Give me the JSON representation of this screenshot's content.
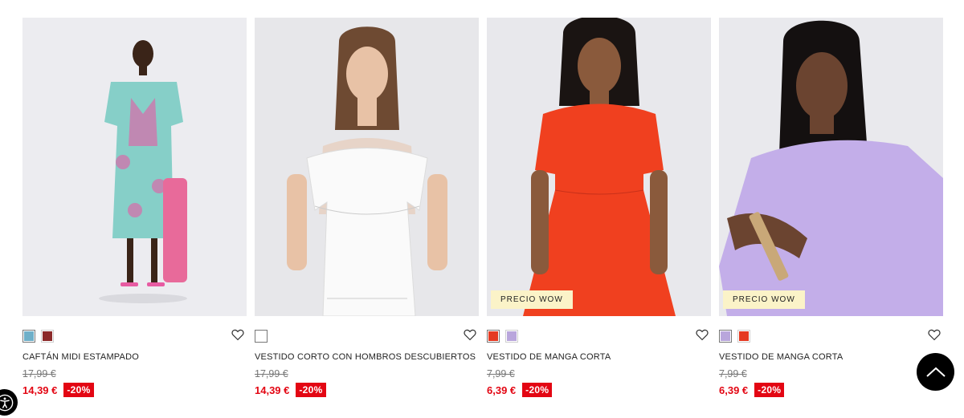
{
  "products": [
    {
      "name": "CAFTÁN MIDI ESTAMPADO",
      "old_price": "17,99 €",
      "price": "14,39 €",
      "discount": "-20%",
      "tag": "",
      "swatches": [
        "#6fb0c9",
        "#8c2a2a"
      ],
      "selected_swatch": 0,
      "photo_bg": "#ececf0",
      "garment_color": "#86cfc8"
    },
    {
      "name": "VESTIDO CORTO CON HOMBROS DESCUBIERTOS",
      "old_price": "17,99 €",
      "price": "14,39 €",
      "discount": "-20%",
      "tag": "",
      "swatches": [
        "#ffffff"
      ],
      "selected_swatch": 0,
      "photo_bg": "#e7e7ea",
      "garment_color": "#fafafa"
    },
    {
      "name": "VESTIDO DE MANGA CORTA",
      "old_price": "7,99 €",
      "price": "6,39 €",
      "discount": "-20%",
      "tag": "PRECIO WOW",
      "swatches": [
        "#e53a22",
        "#b9a6dc"
      ],
      "selected_swatch": 0,
      "photo_bg": "#e8e8ec",
      "garment_color": "#f0401f"
    },
    {
      "name": "VESTIDO DE MANGA CORTA",
      "old_price": "7,99 €",
      "price": "6,39 €",
      "discount": "-20%",
      "tag": "PRECIO WOW",
      "swatches": [
        "#b9a6dc",
        "#e53a22"
      ],
      "selected_swatch": 0,
      "photo_bg": "#e9e9ed",
      "garment_color": "#c3aee9"
    }
  ],
  "icons": {
    "favorite": "heart-outline-icon",
    "scroll_top": "chevron-up-icon",
    "accessibility": "accessibility-icon"
  },
  "colors": {
    "price_red": "#e30613",
    "tag_bg": "#fbf3c8"
  }
}
